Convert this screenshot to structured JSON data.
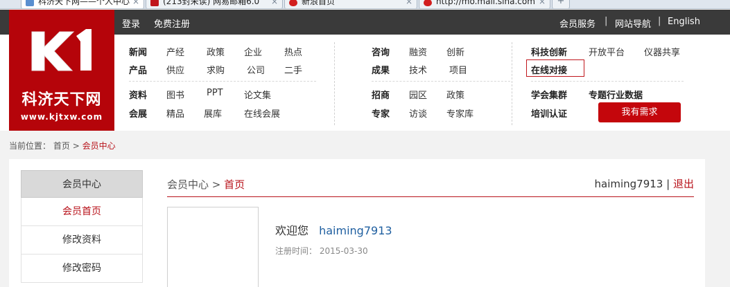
{
  "browser": {
    "tabs": [
      {
        "title": "科济天下网——个人中心",
        "favicon_color": "#5a8fd0",
        "active": true
      },
      {
        "title": "(213封未读) 网易邮箱6.0",
        "favicon_color": "#c0161c",
        "active": false
      },
      {
        "title": "新浪首页",
        "favicon_color": "#d21e1e",
        "active": false
      },
      {
        "title": "http://mo.mail.sina.com",
        "favicon_color": "#d21e1e",
        "active": false
      }
    ],
    "new_tab": "+",
    "close": "×"
  },
  "topbar": {
    "login": "登录",
    "register": "免费注册",
    "member_service": "会员服务",
    "site_nav": "网站导航",
    "english": "English",
    "separator": "|"
  },
  "logo": {
    "mark": "K1",
    "name": "科济天下网",
    "url": "www.kjtxw.com",
    "brand_color": "#b5040a"
  },
  "nav": {
    "news": "新闻",
    "industry": "产经",
    "policy": "政策",
    "enterprise": "企业",
    "hot": "热点",
    "product": "产品",
    "supply": "供应",
    "purchase": "求购",
    "company": "公司",
    "secondhand": "二手",
    "material": "资料",
    "books": "图书",
    "ppt": "PPT",
    "papers": "论文集",
    "expo": "会展",
    "fine": "精品",
    "exhibition_hall": "展库",
    "online_expo": "在线会展",
    "consult": "咨询",
    "finance": "融资",
    "innovation": "创新",
    "achievement": "成果",
    "technology": "技术",
    "project": "项目",
    "investment": "招商",
    "park": "园区",
    "policy2": "政策",
    "expert": "专家",
    "interview": "访谈",
    "expert_lib": "专家库",
    "sci_innovation": "科技创新",
    "open_platform": "开放平台",
    "instrument_share": "仪器共享",
    "online_docking": "在线对接",
    "society_group": "学会集群",
    "industry_data": "专题行业数据",
    "training": "培训认证",
    "need_button": "我有需求"
  },
  "breadcrumb": {
    "prefix": "当前位置：",
    "home": "首页",
    "arrow": ">",
    "current": "会员中心"
  },
  "sidebar": {
    "title": "会员中心",
    "items": [
      {
        "label": "会员首页",
        "active": true
      },
      {
        "label": "修改资料",
        "active": false
      },
      {
        "label": "修改密码",
        "active": false
      }
    ]
  },
  "content": {
    "path_root": "会员中心",
    "path_arrow": ">",
    "path_current": "首页",
    "username": "haiming7913",
    "divider": "|",
    "logout": "退出",
    "welcome": "欢迎您",
    "reg_label": "注册时间：",
    "reg_date": "2015-03-30",
    "accent_color": "#b8121a",
    "link_color": "#1f5fa0"
  }
}
